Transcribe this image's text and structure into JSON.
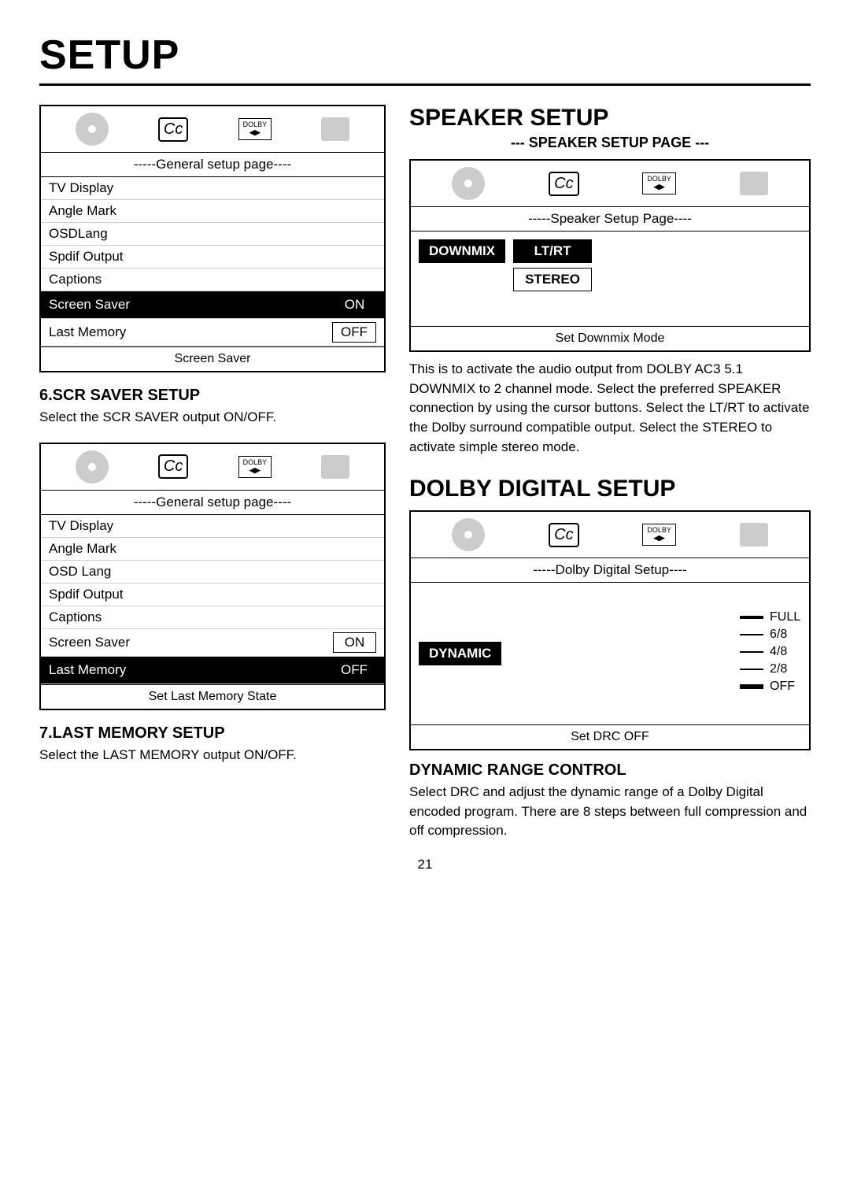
{
  "page": {
    "title": "SETUP",
    "page_number": "21"
  },
  "left_col": {
    "osd1": {
      "header": "-----General setup page----",
      "items": [
        {
          "label": "TV Display",
          "value": "",
          "highlight": false
        },
        {
          "label": "Angle Mark",
          "value": "",
          "highlight": false
        },
        {
          "label": "OSDLang",
          "value": "",
          "highlight": false
        },
        {
          "label": "Spdif Output",
          "value": "",
          "highlight": false
        },
        {
          "label": "Captions",
          "value": "",
          "highlight": false
        },
        {
          "label": "Screen Saver",
          "value": "ON",
          "highlight": true
        },
        {
          "label": "Last Memory",
          "value": "OFF",
          "highlight": false
        }
      ],
      "footer": "Screen Saver"
    },
    "scr_saver": {
      "heading": "6.SCR SAVER SETUP",
      "body": "Select the SCR SAVER output ON/OFF."
    },
    "osd2": {
      "header": "-----General setup page----",
      "items": [
        {
          "label": "TV Display",
          "value": "",
          "highlight": false
        },
        {
          "label": "Angle Mark",
          "value": "",
          "highlight": false
        },
        {
          "label": "OSD Lang",
          "value": "",
          "highlight": false
        },
        {
          "label": "Spdif Output",
          "value": "",
          "highlight": false
        },
        {
          "label": "Captions",
          "value": "",
          "highlight": false
        },
        {
          "label": "Screen Saver",
          "value": "ON",
          "highlight": false
        },
        {
          "label": "Last Memory",
          "value": "OFF",
          "highlight": true
        }
      ],
      "footer": "Set Last Memory State"
    },
    "last_memory": {
      "heading": "7.LAST MEMORY SETUP",
      "body": "Select the LAST MEMORY output ON/OFF."
    }
  },
  "right_col": {
    "speaker_setup": {
      "heading": "SPEAKER SETUP",
      "sub_heading": "--- SPEAKER SETUP PAGE ---",
      "osd_header": "-----Speaker Setup Page----",
      "downmix_label": "DOWNMIX",
      "lt_rt_label": "LT/RT",
      "stereo_label": "STEREO",
      "footer": "Set Downmix Mode",
      "description": "This is to activate the audio output from DOLBY AC3 5.1 DOWNMIX to 2 channel mode.  Select the preferred SPEAKER connection by using the cursor buttons. Select the LT/RT to activate the Dolby surround compatible output. Select the STEREO to activate simple stereo mode."
    },
    "dolby_digital": {
      "heading": "DOLBY DIGITAL SETUP",
      "osd_header": "-----Dolby Digital Setup----",
      "dynamic_label": "DYNAMIC",
      "slider_items": [
        {
          "label": "FULL",
          "selected": false
        },
        {
          "label": "6/8",
          "selected": false
        },
        {
          "label": "4/8",
          "selected": false
        },
        {
          "label": "2/8",
          "selected": false
        },
        {
          "label": "OFF",
          "selected": true
        }
      ],
      "footer": "Set DRC OFF",
      "drc_heading": "DYNAMIC RANGE CONTROL",
      "drc_description": "Select DRC and adjust the dynamic range of a Dolby Digital encoded program.  There are 8 steps between full compression and off compression."
    }
  },
  "icons": {
    "disc": "disc-icon",
    "cc": "cc-icon",
    "dolby": "dolby-icon",
    "screen": "screen-icon"
  }
}
